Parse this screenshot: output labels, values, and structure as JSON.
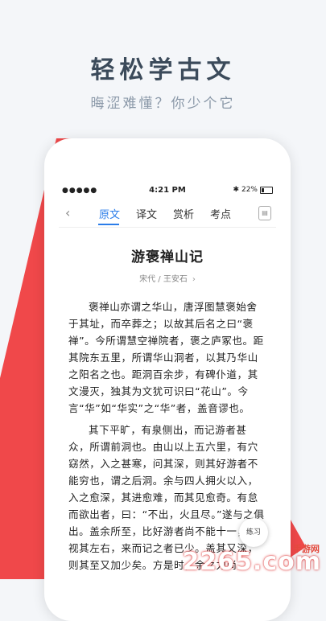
{
  "promo": {
    "headline": "轻松学古文",
    "subline": "晦涩难懂？你少个它"
  },
  "status": {
    "signal": "●●●●●",
    "time": "4:21 PM",
    "battery": "22%"
  },
  "tabs": [
    {
      "label": "原文"
    },
    {
      "label": "译文"
    },
    {
      "label": "赏析"
    },
    {
      "label": "考点"
    }
  ],
  "article": {
    "title": "游褒禅山记",
    "meta": "宋代 / 王安石",
    "paragraphs": [
      "褒禅山亦谓之华山，唐浮图慧褒始舍于其址，而卒葬之；以故其后名之曰“褒禅”。今所谓慧空禅院者，褒之庐冢也。距其院东五里，所谓华山洞者，以其乃华山之阳名之也。距洞百余步，有碑仆道，其文漫灭，独其为文犹可识曰“花山”。今言“华”如“华实”之“华”者，盖音谬也。",
      "其下平旷，有泉侧出，而记游者甚众，所谓前洞也。由山以上五六里，有穴窈然，入之甚寒，问其深，则其好游者不能穷也，谓之后洞。余与四人拥火以入，入之愈深，其进愈难，而其见愈奇。有怠而欲出者，曰：“不出，火且尽。”遂与之俱出。盖余所至，比好游者尚不能十一，然视其左右，来而记之者已少。盖其又深，则其至又加少矣。方是时，余之力尚"
    ]
  },
  "fab": {
    "label": "练习"
  },
  "watermark": {
    "text": "2265.com",
    "small": "手游网"
  },
  "colors": {
    "accent": "#2b7de9",
    "brand_red": "#f0484a"
  }
}
